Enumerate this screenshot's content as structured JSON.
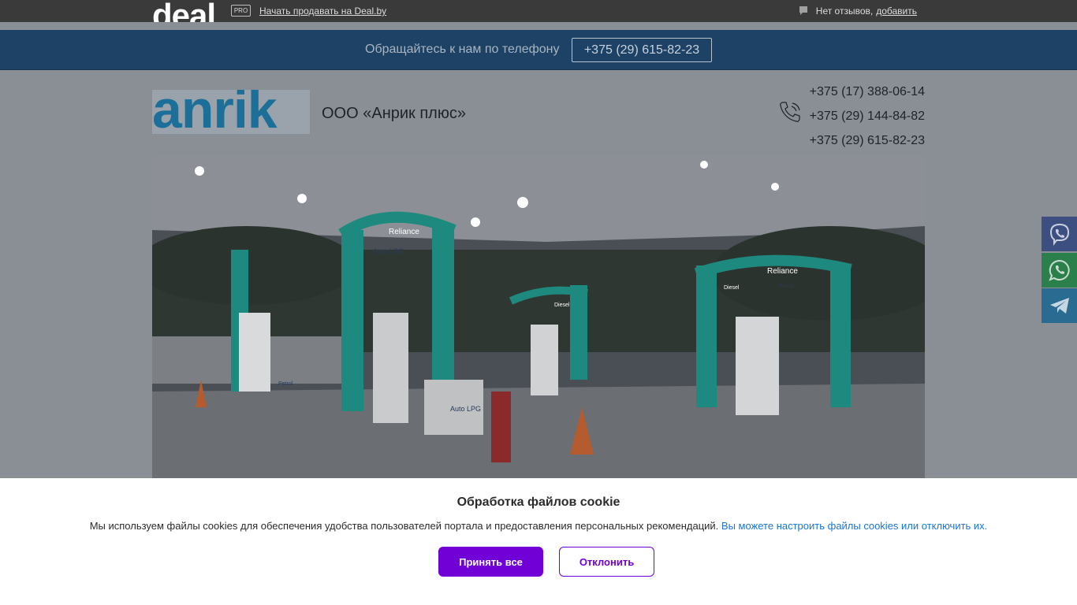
{
  "topbar": {
    "logo": "deal",
    "pro_badge": "PRO",
    "sell_link": "Начать продавать на Deal.by",
    "reviews_text": "Нет отзывов,",
    "reviews_add": "добавить"
  },
  "phonebar": {
    "label": "Обращайтесь к нам по телефону",
    "phone": "+375 (29) 615-82-23"
  },
  "header": {
    "logo_text": "anrik",
    "company_name": "ООО «Анрик плюс»",
    "phones": [
      "+375 (17) 388-06-14",
      "+375 (29) 144-84-82",
      "+375 (29) 615-82-23"
    ]
  },
  "hero": {
    "signs": [
      "Reliance",
      "Auto LPG",
      "Diesel",
      "Petrol",
      "Reliance",
      "Diesel",
      "Petrol",
      "Auto LPG"
    ]
  },
  "messengers": [
    "viber-icon",
    "whatsapp-icon",
    "telegram-icon"
  ],
  "cookie": {
    "title": "Обработка файлов cookie",
    "text": "Мы используем файлы cookies для обеспечения удобства пользователей портала и предоставления персональных рекомендаций.",
    "link": "Вы можете настроить файлы cookies или отключить их.",
    "accept": "Принять все",
    "decline": "Отклонить"
  },
  "colors": {
    "accent": "#7000d6",
    "phonebar": "#1d4266",
    "link": "#1976d2"
  }
}
